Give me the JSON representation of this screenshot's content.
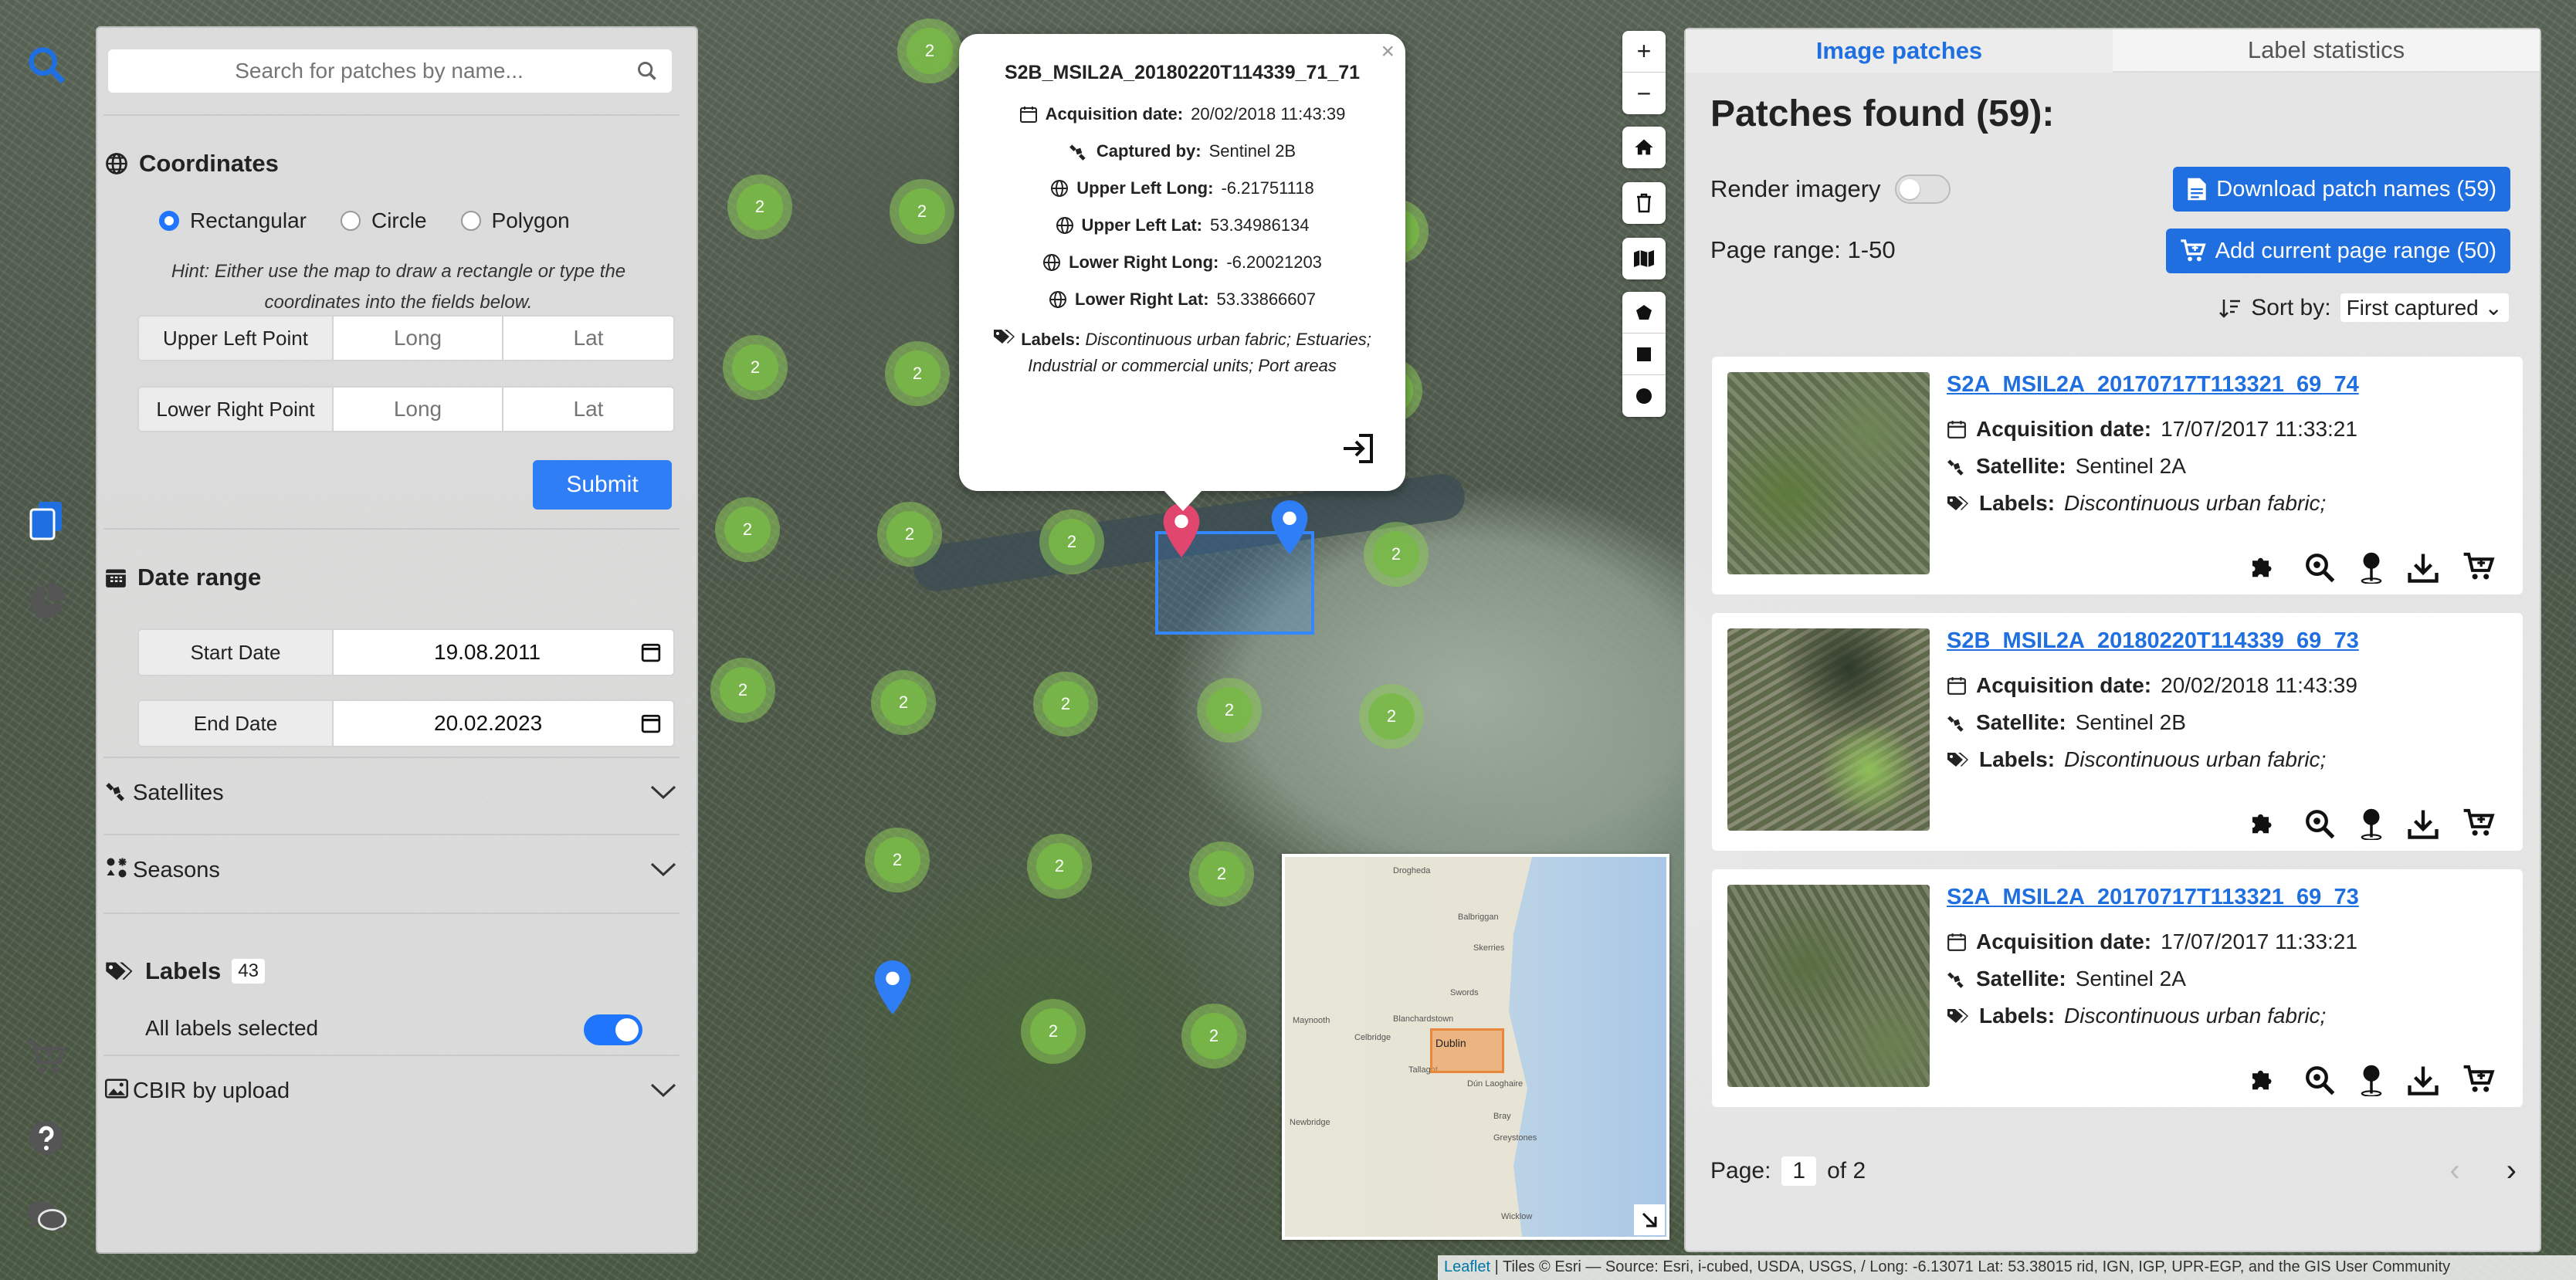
{
  "sidebar_icons": [
    "search-icon",
    "document-copy-icon",
    "pie-chart-icon",
    "cart-icon",
    "help-icon",
    "chat-icon"
  ],
  "filters": {
    "search_placeholder": "Search for patches by name...",
    "coordinates": {
      "title": "Coordinates",
      "modes": [
        "Rectangular",
        "Circle",
        "Polygon"
      ],
      "selected_mode": "Rectangular",
      "hint": "Hint: Either use the map to draw a rectangle or type the coordinates into the fields below.",
      "upper_left_label": "Upper Left Point",
      "lower_right_label": "Lower Right Point",
      "long_placeholder": "Long",
      "lat_placeholder": "Lat",
      "submit_label": "Submit"
    },
    "date_range": {
      "title": "Date range",
      "start_label": "Start Date",
      "start_value": "19.08.2011",
      "end_label": "End Date",
      "end_value": "20.02.2023"
    },
    "satellites_label": "Satellites",
    "seasons_label": "Seasons",
    "labels": {
      "title": "Labels",
      "count": "43",
      "all_selected_text": "All labels selected"
    },
    "cbir_label": "CBIR by upload"
  },
  "map": {
    "cluster_count_label": "2",
    "zoom_in": "+",
    "zoom_out": "−",
    "popup": {
      "title": "S2B_MSIL2A_20180220T114339_71_71",
      "acq_label": "Acquisition date:",
      "acq_value": "20/02/2018 11:43:39",
      "captured_label": "Captured by:",
      "captured_value": "Sentinel 2B",
      "ul_long_label": "Upper Left Long:",
      "ul_long_value": "-6.21751118",
      "ul_lat_label": "Upper Left Lat:",
      "ul_lat_value": "53.34986134",
      "lr_long_label": "Lower Right Long:",
      "lr_long_value": "-6.20021203",
      "lr_lat_label": "Lower Right Lat:",
      "lr_lat_value": "53.33866607",
      "labels_label": "Labels:",
      "labels_value": "Discontinuous urban fabric; Estuaries; Industrial or commercial units; Port areas"
    },
    "minimap": {
      "places": [
        "Drogheda",
        "Balbriggan",
        "Skerries",
        "Swords",
        "Blanchardstown",
        "Maynooth",
        "Celbridge",
        "Tallaght",
        "Dún Laoghaire",
        "Bray",
        "Greystones",
        "Newbridge",
        "Wicklow"
      ],
      "highlight_label": "Dublin"
    },
    "attribution_link": "Leaflet",
    "attribution_text": "| Tiles © Esri — Source: Esri, i-cubed, USDA, USGS, / Long: -6.13071  Lat: 53.38015 rid, IGN, IGP, UPR-EGP, and the GIS User Community"
  },
  "results": {
    "tab_patches": "Image patches",
    "tab_stats": "Label statistics",
    "found_title": "Patches found (59):",
    "render_label": "Render imagery",
    "page_range": "Page range: 1-50",
    "download_label": "Download patch names (59)",
    "add_range_label": "Add current page range (50)",
    "sort_label": "Sort by:",
    "sort_value": "First captured",
    "patches": [
      {
        "name": "S2A_MSIL2A_20170717T113321_69_74",
        "acq_label": "Acquisition date:",
        "acq_value": "17/07/2017 11:33:21",
        "sat_label": "Satellite:",
        "sat_value": "Sentinel 2A",
        "labels_label": "Labels:",
        "labels_value": "Discontinuous urban fabric;"
      },
      {
        "name": "S2B_MSIL2A_20180220T114339_69_73",
        "acq_label": "Acquisition date:",
        "acq_value": "20/02/2018 11:43:39",
        "sat_label": "Satellite:",
        "sat_value": "Sentinel 2B",
        "labels_label": "Labels:",
        "labels_value": "Discontinuous urban fabric;"
      },
      {
        "name": "S2A_MSIL2A_20170717T113321_69_73",
        "acq_label": "Acquisition date:",
        "acq_value": "17/07/2017 11:33:21",
        "sat_label": "Satellite:",
        "sat_value": "Sentinel 2A",
        "labels_label": "Labels:",
        "labels_value": "Discontinuous urban fabric;"
      }
    ],
    "page_label": "Page:",
    "page_current": "1",
    "page_total": "of 2",
    "colors": {
      "accent": "#1f6fe0",
      "cluster": "#78b946",
      "marker_red": "#e0466e",
      "marker_blue": "#2f7ef5"
    }
  }
}
